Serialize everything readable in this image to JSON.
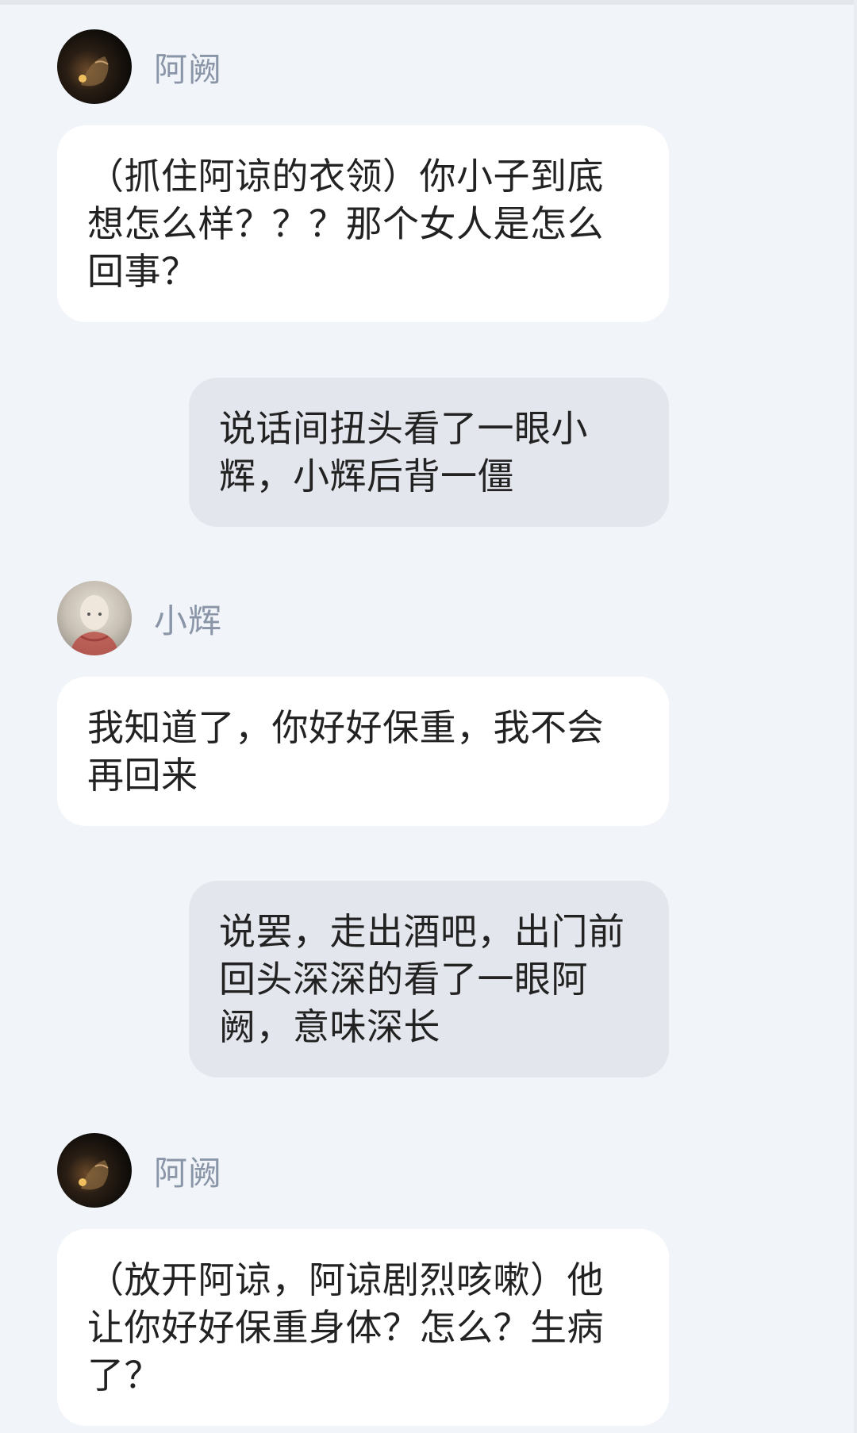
{
  "messages": [
    {
      "type": "incoming",
      "sender": "阿阙",
      "avatar": "dark-avatar",
      "text": "（抓住阿谅的衣领）你小子到底想怎么样？？？那个女人是怎么回事？"
    },
    {
      "type": "outgoing",
      "text": "说话间扭头看了一眼小辉，小辉后背一僵"
    },
    {
      "type": "incoming",
      "sender": "小辉",
      "avatar": "light-avatar",
      "text": "我知道了，你好好保重，我不会再回来"
    },
    {
      "type": "outgoing",
      "text": "说罢，走出酒吧，出门前回头深深的看了一眼阿阙，意味深长"
    },
    {
      "type": "incoming",
      "sender": "阿阙",
      "avatar": "dark-avatar",
      "text": "（放开阿谅，阿谅剧烈咳嗽）他让你好好保重身体？怎么？生病了？"
    }
  ],
  "colors": {
    "background": "#f1f4f9",
    "incoming_bubble": "#ffffff",
    "outgoing_bubble": "#e3e6ed",
    "name_text": "#8a96a8",
    "message_text": "#222222"
  }
}
